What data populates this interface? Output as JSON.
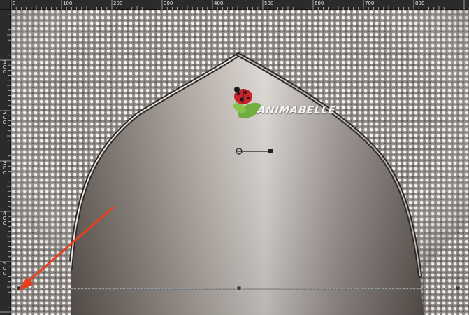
{
  "ruler": {
    "top_labels": [
      "0",
      "100",
      "200",
      "300",
      "400",
      "500",
      "600",
      "700",
      "800"
    ],
    "left_labels": [
      "1\n0\n0",
      "2\n0\n0",
      "3\n0\n0",
      "4\n0\n0",
      "5\n0\n0"
    ]
  },
  "watermark": {
    "text": "ANIMABELLE"
  },
  "colors": {
    "ruler_background": "#2b2b2b",
    "ruler_text": "#e6e6e6",
    "arrow": "#e8401c",
    "pattern_base": "#8a8580",
    "arch_light": "#dcd6d2",
    "arch_dark": "#6e655f",
    "guide_line": "#9ea0a2"
  },
  "icons": {
    "annotation": "red-arrow-icon",
    "logo": "ladybug-logo-icon",
    "rotation_handle": "rotation-handle-icon",
    "node_handle": "node-handle-icon"
  }
}
